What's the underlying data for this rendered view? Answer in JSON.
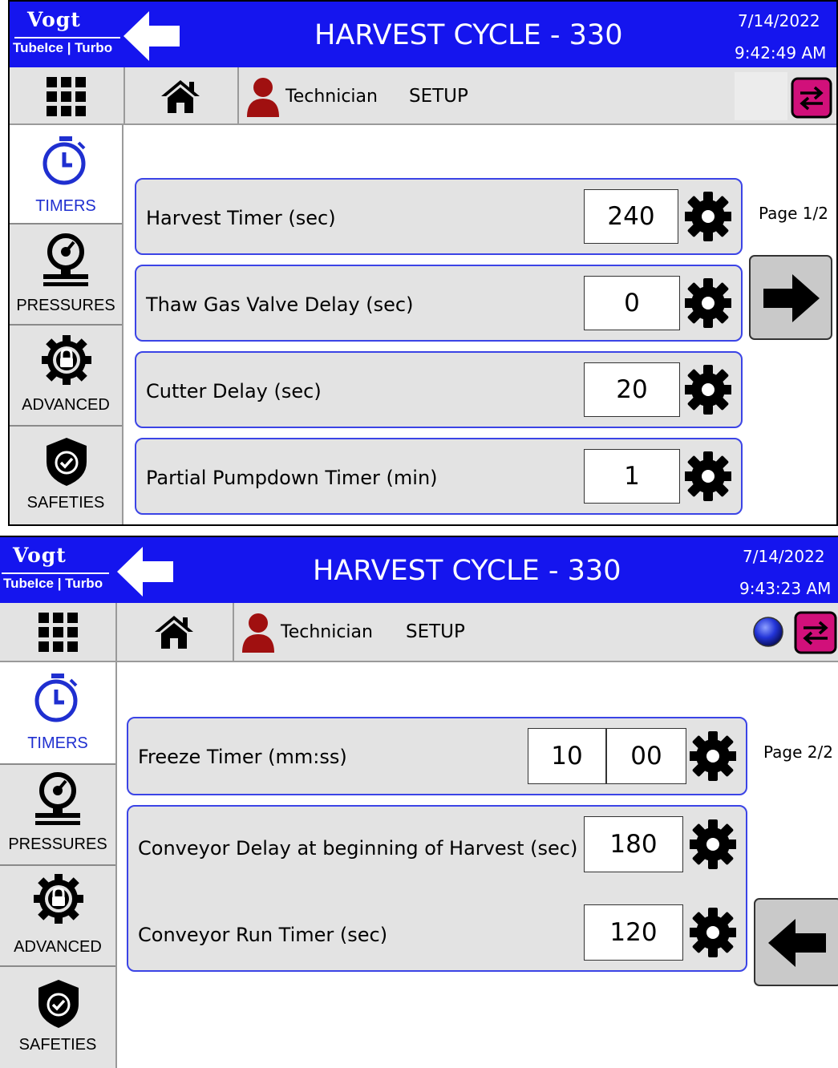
{
  "screens": [
    {
      "logo": {
        "brand": "Vogt",
        "sub": "TubeIce | Turbo"
      },
      "title": "HARVEST CYCLE - 330",
      "date": "7/14/2022",
      "time": "9:42:49 AM",
      "toolbar": {
        "user": "Technician",
        "mode": "SETUP"
      },
      "sidebar": [
        {
          "label": "TIMERS",
          "icon": "stopwatch-icon",
          "active": true
        },
        {
          "label": "PRESSURES",
          "icon": "pressure-gauge-icon",
          "active": false
        },
        {
          "label": "ADVANCED",
          "icon": "lock-gear-icon",
          "active": false
        },
        {
          "label": "SAFETIES",
          "icon": "shield-check-icon",
          "active": false
        }
      ],
      "rows": [
        {
          "label": "Harvest Timer (sec)",
          "value": "240"
        },
        {
          "label": "Thaw Gas Valve Delay (sec)",
          "value": "0"
        },
        {
          "label": "Cutter Delay (sec)",
          "value": "20"
        },
        {
          "label": "Partial Pumpdown Timer (min)",
          "value": "1"
        }
      ],
      "page": "Page 1/2",
      "nav": "next-arrow-icon"
    },
    {
      "logo": {
        "brand": "Vogt",
        "sub": "TubeIce | Turbo"
      },
      "title": "HARVEST CYCLE - 330",
      "date": "7/14/2022",
      "time": "9:43:23 AM",
      "toolbar": {
        "user": "Technician",
        "mode": "SETUP"
      },
      "sidebar": [
        {
          "label": "TIMERS",
          "icon": "stopwatch-icon",
          "active": true
        },
        {
          "label": "PRESSURES",
          "icon": "pressure-gauge-icon",
          "active": false
        },
        {
          "label": "ADVANCED",
          "icon": "lock-gear-icon",
          "active": false
        },
        {
          "label": "SAFETIES",
          "icon": "shield-check-icon",
          "active": false
        }
      ],
      "rows": [
        {
          "label": "Freeze Timer (mm:ss)",
          "minutes": "10",
          "seconds": "00"
        },
        {
          "label": "Conveyor Delay at beginning of Harvest (sec)",
          "value": "180"
        },
        {
          "label": "Conveyor Run Timer (sec)",
          "value": "120"
        }
      ],
      "page": "Page 2/2",
      "nav": "previous-arrow-icon"
    }
  ],
  "colors": {
    "header_blue": "#1515ee",
    "panel_border": "#3b44e6",
    "panel_fill": "#e3e3e3",
    "user_icon": "#a01010",
    "switch_icon": "#d1107a",
    "active_tab_text": "#1f2fd0"
  }
}
